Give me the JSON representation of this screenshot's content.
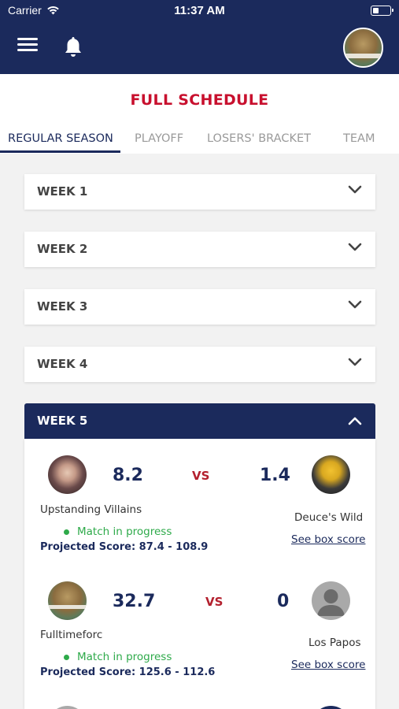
{
  "status_bar": {
    "carrier": "Carrier",
    "time": "11:37 AM"
  },
  "navbar": {
    "menu_icon": "hamburger-icon",
    "bell_icon": "bell-icon"
  },
  "page": {
    "title": "FULL SCHEDULE"
  },
  "tabs": [
    {
      "label": "REGULAR SEASON",
      "active": true
    },
    {
      "label": "PLAYOFF",
      "active": false
    },
    {
      "label": "LOSERS' BRACKET",
      "active": false
    },
    {
      "label": "TEAM",
      "active": false
    }
  ],
  "weeks": [
    {
      "label": "WEEK 1",
      "expanded": false
    },
    {
      "label": "WEEK 2",
      "expanded": false
    },
    {
      "label": "WEEK 3",
      "expanded": false
    },
    {
      "label": "WEEK 4",
      "expanded": false
    },
    {
      "label": "WEEK 5",
      "expanded": true
    }
  ],
  "matchups": [
    {
      "home_team": "Upstanding Villains",
      "home_score": "8.2",
      "vs": "VS",
      "away_score": "1.4",
      "away_team": "Deuce's Wild",
      "status": "Match in progress",
      "projected": "Projected Score:  87.4 - 108.9",
      "box_link": "See box score"
    },
    {
      "home_team": "Fulltimeforc",
      "home_score": "32.7",
      "vs": "VS",
      "away_score": "0",
      "away_team": "Los Papos",
      "status": "Match in progress",
      "projected": "Projected Score:  125.6 - 112.6",
      "box_link": "See box score"
    }
  ],
  "colors": {
    "navy": "#1b2a5c",
    "red": "#c8102e",
    "green": "#2eaa4a"
  }
}
